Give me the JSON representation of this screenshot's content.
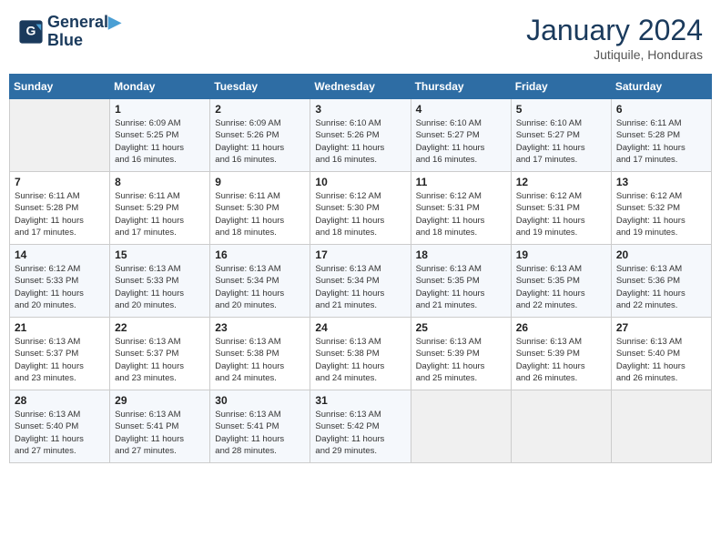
{
  "header": {
    "logo_line1": "General",
    "logo_line2": "Blue",
    "month_title": "January 2024",
    "subtitle": "Jutiquile, Honduras"
  },
  "days_of_week": [
    "Sunday",
    "Monday",
    "Tuesday",
    "Wednesday",
    "Thursday",
    "Friday",
    "Saturday"
  ],
  "weeks": [
    [
      {
        "num": "",
        "info": ""
      },
      {
        "num": "1",
        "info": "Sunrise: 6:09 AM\nSunset: 5:25 PM\nDaylight: 11 hours\nand 16 minutes."
      },
      {
        "num": "2",
        "info": "Sunrise: 6:09 AM\nSunset: 5:26 PM\nDaylight: 11 hours\nand 16 minutes."
      },
      {
        "num": "3",
        "info": "Sunrise: 6:10 AM\nSunset: 5:26 PM\nDaylight: 11 hours\nand 16 minutes."
      },
      {
        "num": "4",
        "info": "Sunrise: 6:10 AM\nSunset: 5:27 PM\nDaylight: 11 hours\nand 16 minutes."
      },
      {
        "num": "5",
        "info": "Sunrise: 6:10 AM\nSunset: 5:27 PM\nDaylight: 11 hours\nand 17 minutes."
      },
      {
        "num": "6",
        "info": "Sunrise: 6:11 AM\nSunset: 5:28 PM\nDaylight: 11 hours\nand 17 minutes."
      }
    ],
    [
      {
        "num": "7",
        "info": "Sunrise: 6:11 AM\nSunset: 5:28 PM\nDaylight: 11 hours\nand 17 minutes."
      },
      {
        "num": "8",
        "info": "Sunrise: 6:11 AM\nSunset: 5:29 PM\nDaylight: 11 hours\nand 17 minutes."
      },
      {
        "num": "9",
        "info": "Sunrise: 6:11 AM\nSunset: 5:30 PM\nDaylight: 11 hours\nand 18 minutes."
      },
      {
        "num": "10",
        "info": "Sunrise: 6:12 AM\nSunset: 5:30 PM\nDaylight: 11 hours\nand 18 minutes."
      },
      {
        "num": "11",
        "info": "Sunrise: 6:12 AM\nSunset: 5:31 PM\nDaylight: 11 hours\nand 18 minutes."
      },
      {
        "num": "12",
        "info": "Sunrise: 6:12 AM\nSunset: 5:31 PM\nDaylight: 11 hours\nand 19 minutes."
      },
      {
        "num": "13",
        "info": "Sunrise: 6:12 AM\nSunset: 5:32 PM\nDaylight: 11 hours\nand 19 minutes."
      }
    ],
    [
      {
        "num": "14",
        "info": "Sunrise: 6:12 AM\nSunset: 5:33 PM\nDaylight: 11 hours\nand 20 minutes."
      },
      {
        "num": "15",
        "info": "Sunrise: 6:13 AM\nSunset: 5:33 PM\nDaylight: 11 hours\nand 20 minutes."
      },
      {
        "num": "16",
        "info": "Sunrise: 6:13 AM\nSunset: 5:34 PM\nDaylight: 11 hours\nand 20 minutes."
      },
      {
        "num": "17",
        "info": "Sunrise: 6:13 AM\nSunset: 5:34 PM\nDaylight: 11 hours\nand 21 minutes."
      },
      {
        "num": "18",
        "info": "Sunrise: 6:13 AM\nSunset: 5:35 PM\nDaylight: 11 hours\nand 21 minutes."
      },
      {
        "num": "19",
        "info": "Sunrise: 6:13 AM\nSunset: 5:35 PM\nDaylight: 11 hours\nand 22 minutes."
      },
      {
        "num": "20",
        "info": "Sunrise: 6:13 AM\nSunset: 5:36 PM\nDaylight: 11 hours\nand 22 minutes."
      }
    ],
    [
      {
        "num": "21",
        "info": "Sunrise: 6:13 AM\nSunset: 5:37 PM\nDaylight: 11 hours\nand 23 minutes."
      },
      {
        "num": "22",
        "info": "Sunrise: 6:13 AM\nSunset: 5:37 PM\nDaylight: 11 hours\nand 23 minutes."
      },
      {
        "num": "23",
        "info": "Sunrise: 6:13 AM\nSunset: 5:38 PM\nDaylight: 11 hours\nand 24 minutes."
      },
      {
        "num": "24",
        "info": "Sunrise: 6:13 AM\nSunset: 5:38 PM\nDaylight: 11 hours\nand 24 minutes."
      },
      {
        "num": "25",
        "info": "Sunrise: 6:13 AM\nSunset: 5:39 PM\nDaylight: 11 hours\nand 25 minutes."
      },
      {
        "num": "26",
        "info": "Sunrise: 6:13 AM\nSunset: 5:39 PM\nDaylight: 11 hours\nand 26 minutes."
      },
      {
        "num": "27",
        "info": "Sunrise: 6:13 AM\nSunset: 5:40 PM\nDaylight: 11 hours\nand 26 minutes."
      }
    ],
    [
      {
        "num": "28",
        "info": "Sunrise: 6:13 AM\nSunset: 5:40 PM\nDaylight: 11 hours\nand 27 minutes."
      },
      {
        "num": "29",
        "info": "Sunrise: 6:13 AM\nSunset: 5:41 PM\nDaylight: 11 hours\nand 27 minutes."
      },
      {
        "num": "30",
        "info": "Sunrise: 6:13 AM\nSunset: 5:41 PM\nDaylight: 11 hours\nand 28 minutes."
      },
      {
        "num": "31",
        "info": "Sunrise: 6:13 AM\nSunset: 5:42 PM\nDaylight: 11 hours\nand 29 minutes."
      },
      {
        "num": "",
        "info": ""
      },
      {
        "num": "",
        "info": ""
      },
      {
        "num": "",
        "info": ""
      }
    ]
  ]
}
